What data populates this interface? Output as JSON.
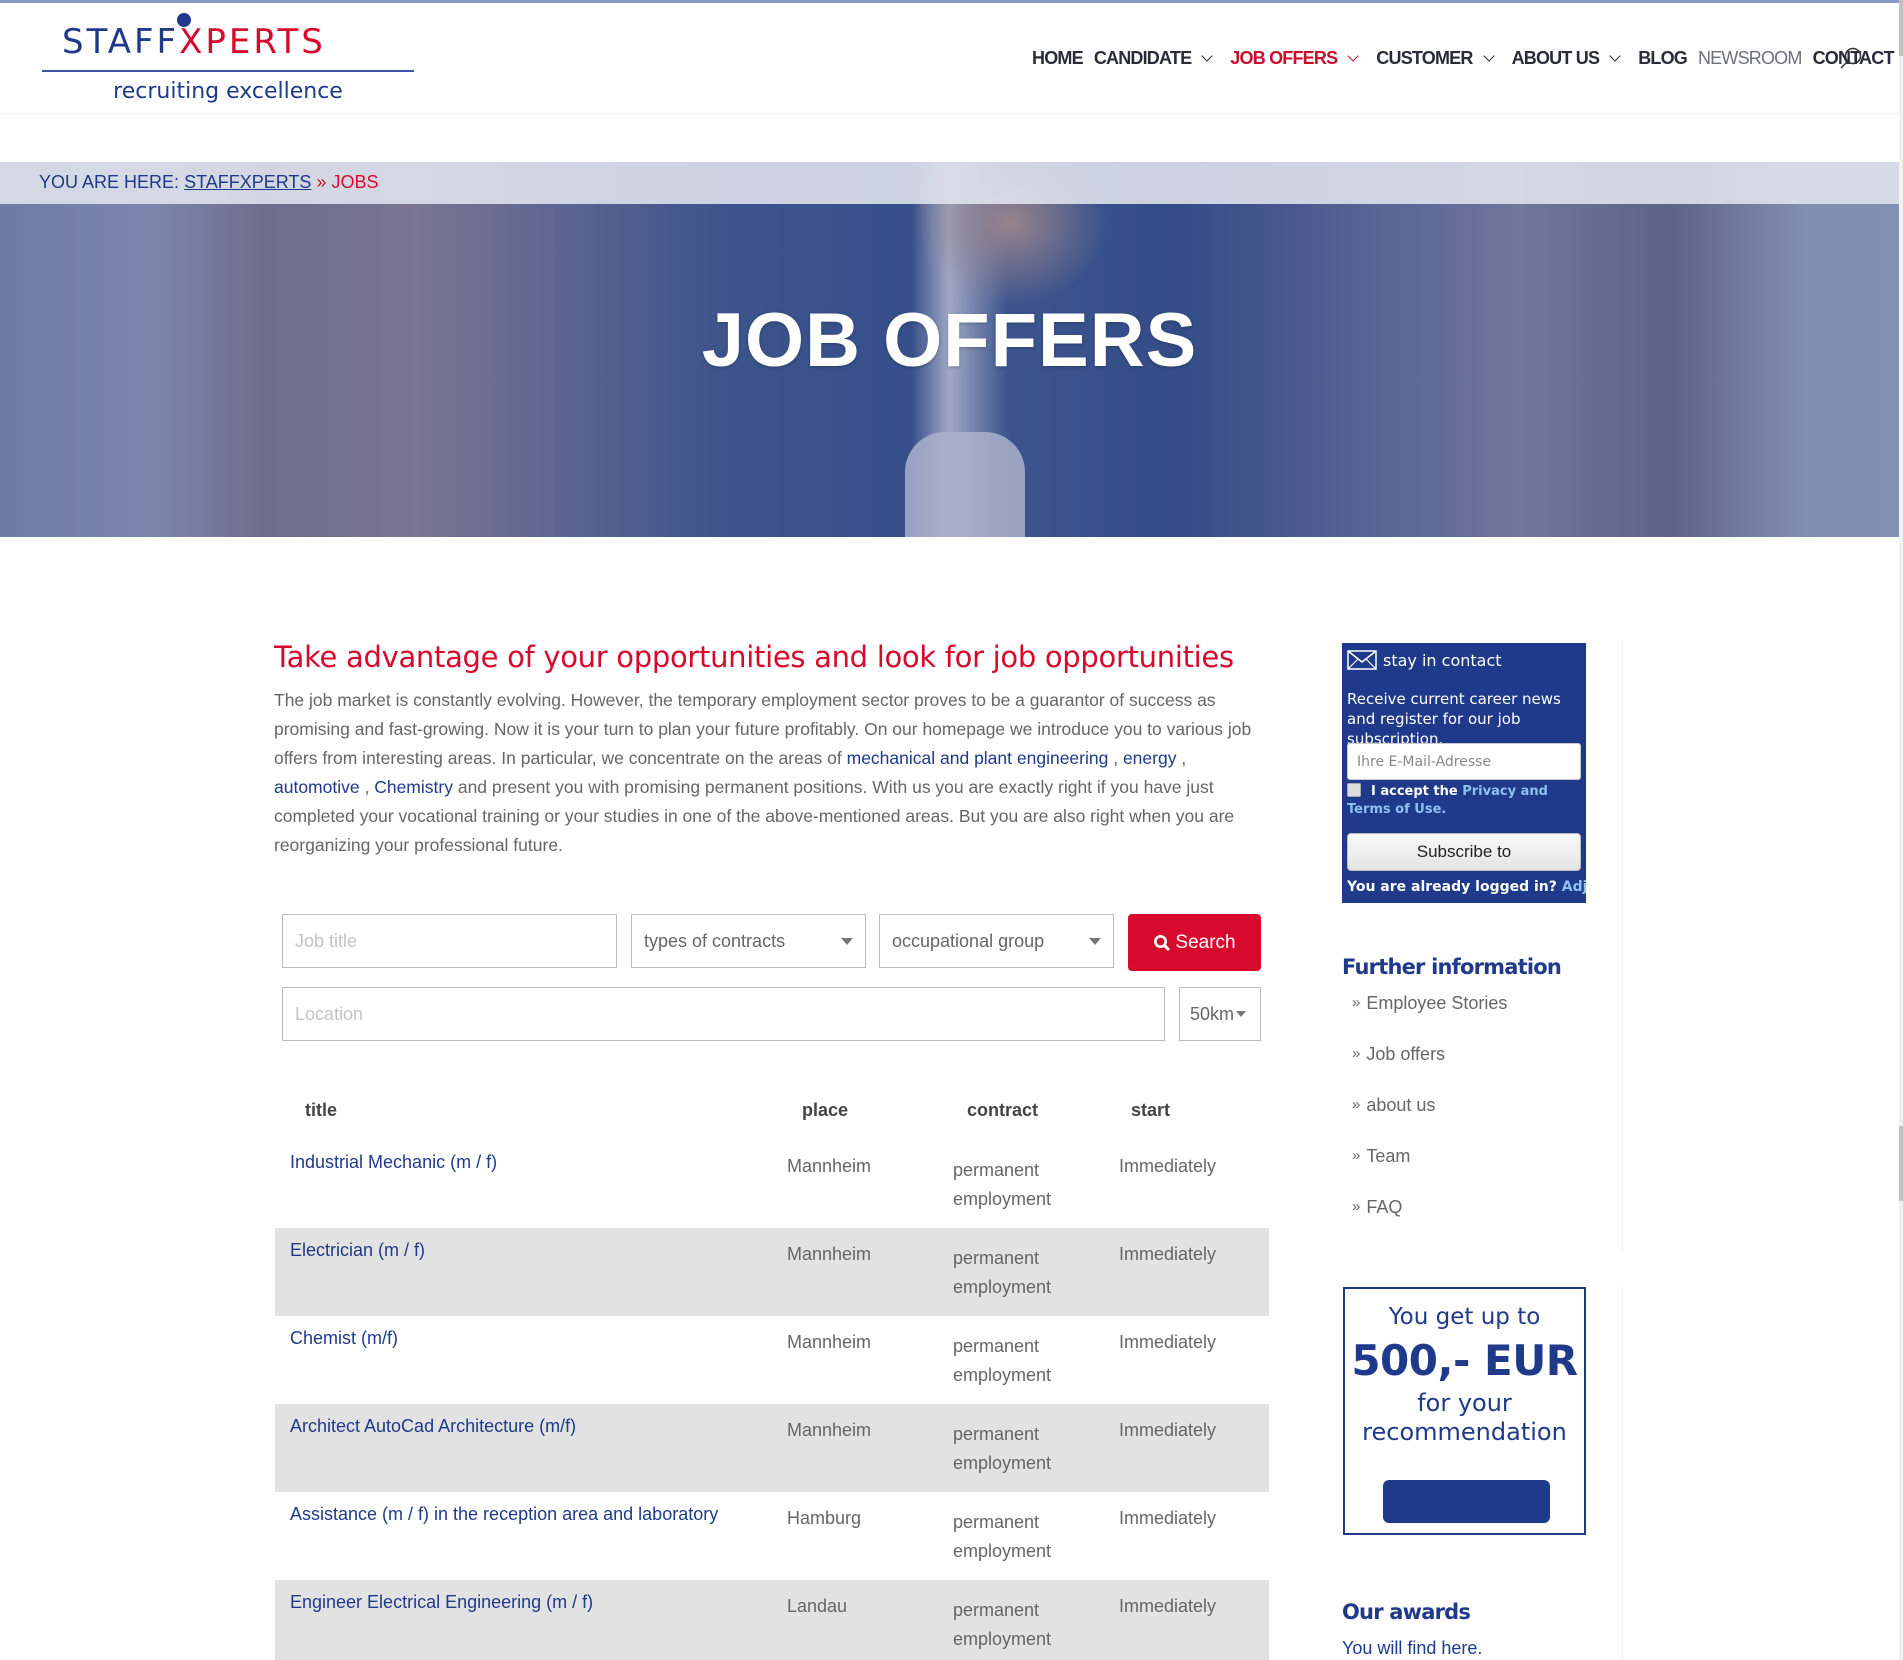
{
  "brand": {
    "logo_part1": "STA",
    "logo_part2": "FF",
    "logo_part3": "XPERTS",
    "tagline": "recruiting excellence",
    "colors": {
      "primary": "#1f3a8a",
      "accent": "#d70a2d"
    }
  },
  "nav": {
    "items": [
      {
        "label": "HOME",
        "dropdown": false
      },
      {
        "label": "CANDIDATE",
        "dropdown": true
      },
      {
        "label": "JOB OFFERS",
        "dropdown": true,
        "active": true
      },
      {
        "label": "CUSTOMER",
        "dropdown": true
      },
      {
        "label": "ABOUT US",
        "dropdown": true
      },
      {
        "label": "BLOG",
        "dropdown": false
      },
      {
        "label": "NEWSROOM",
        "dropdown": false
      },
      {
        "label": "CONTACT",
        "dropdown": false
      }
    ],
    "search_icon": "search-icon"
  },
  "breadcrumb": {
    "prefix": "YOU ARE HERE:",
    "home": "STAFFXPERTS",
    "separator": "»",
    "current": "JOBS"
  },
  "hero": {
    "title": "JOB OFFERS"
  },
  "intro": {
    "title": "Take advantage of your opportunities and look for job opportunities",
    "p1": "The job market is constantly evolving. However, the temporary employment sector proves to be a guarantor of success as promising and fast-growing. Now it is your turn to plan your future profitably. On our homepage we introduce you to various job offers from interesting areas. In particular, we concentrate on the areas of ",
    "link1": "mechanical and plant engineering",
    "sep1": " , ",
    "link2": "energy",
    "sep2": " , ",
    "link3": "automotive",
    "sep3": " , ",
    "link4": "Chemistry",
    "p2": " and present you with promising permanent positions. With us you are exactly right if you have just completed your vocational training or your studies in one of the above-mentioned areas. But you are also right when you are reorganizing your professional future."
  },
  "search_form": {
    "job_title_placeholder": "Job title",
    "job_title_value": "",
    "contract_type": "types of contracts",
    "occupational_group": "occupational group",
    "search_label": "Search",
    "location_placeholder": "Location",
    "location_value": "",
    "radius": "50km"
  },
  "jobs": {
    "columns": [
      "title",
      "place",
      "contract",
      "start"
    ],
    "rows": [
      {
        "title": "Industrial Mechanic (m / f)",
        "place": "Mannheim",
        "contract": "permanent employment",
        "start": "Immediately"
      },
      {
        "title": "Electrician (m / f)",
        "place": "Mannheim",
        "contract": "permanent employment",
        "start": "Immediately"
      },
      {
        "title": "Chemist (m/f)",
        "place": "Mannheim",
        "contract": "permanent employment",
        "start": "Immediately"
      },
      {
        "title": "Architect AutoCad Architecture (m/f)",
        "place": "Mannheim",
        "contract": "permanent employment",
        "start": "Immediately"
      },
      {
        "title": "Assistance (m / f) in the reception area and laboratory",
        "place": "Hamburg",
        "contract": "permanent employment",
        "start": "Immediately"
      },
      {
        "title": "Engineer Electrical Engineering (m / f)",
        "place": "Landau",
        "contract": "permanent employment",
        "start": "Immediately"
      }
    ]
  },
  "newsletter": {
    "title": "stay in contact",
    "text": "Receive current career news and register for our job subscription.",
    "email_placeholder": "Ihre E-Mail-Adresse",
    "accept_prefix": "I accept the ",
    "accept_link": "Privacy and Terms of Use.",
    "subscribe_label": "Subscribe to",
    "logged_prefix": "You are already logged in? ",
    "logged_link": "Adjust your profile"
  },
  "further_info": {
    "title": "Further information",
    "items": [
      "Employee Stories",
      "Job offers",
      "about us",
      "Team",
      "FAQ"
    ]
  },
  "reward": {
    "line1": "You get up to",
    "amount": "500,- EUR",
    "line3": "for your recommendation"
  },
  "awards": {
    "title": "Our awards",
    "text": "You will find here."
  }
}
